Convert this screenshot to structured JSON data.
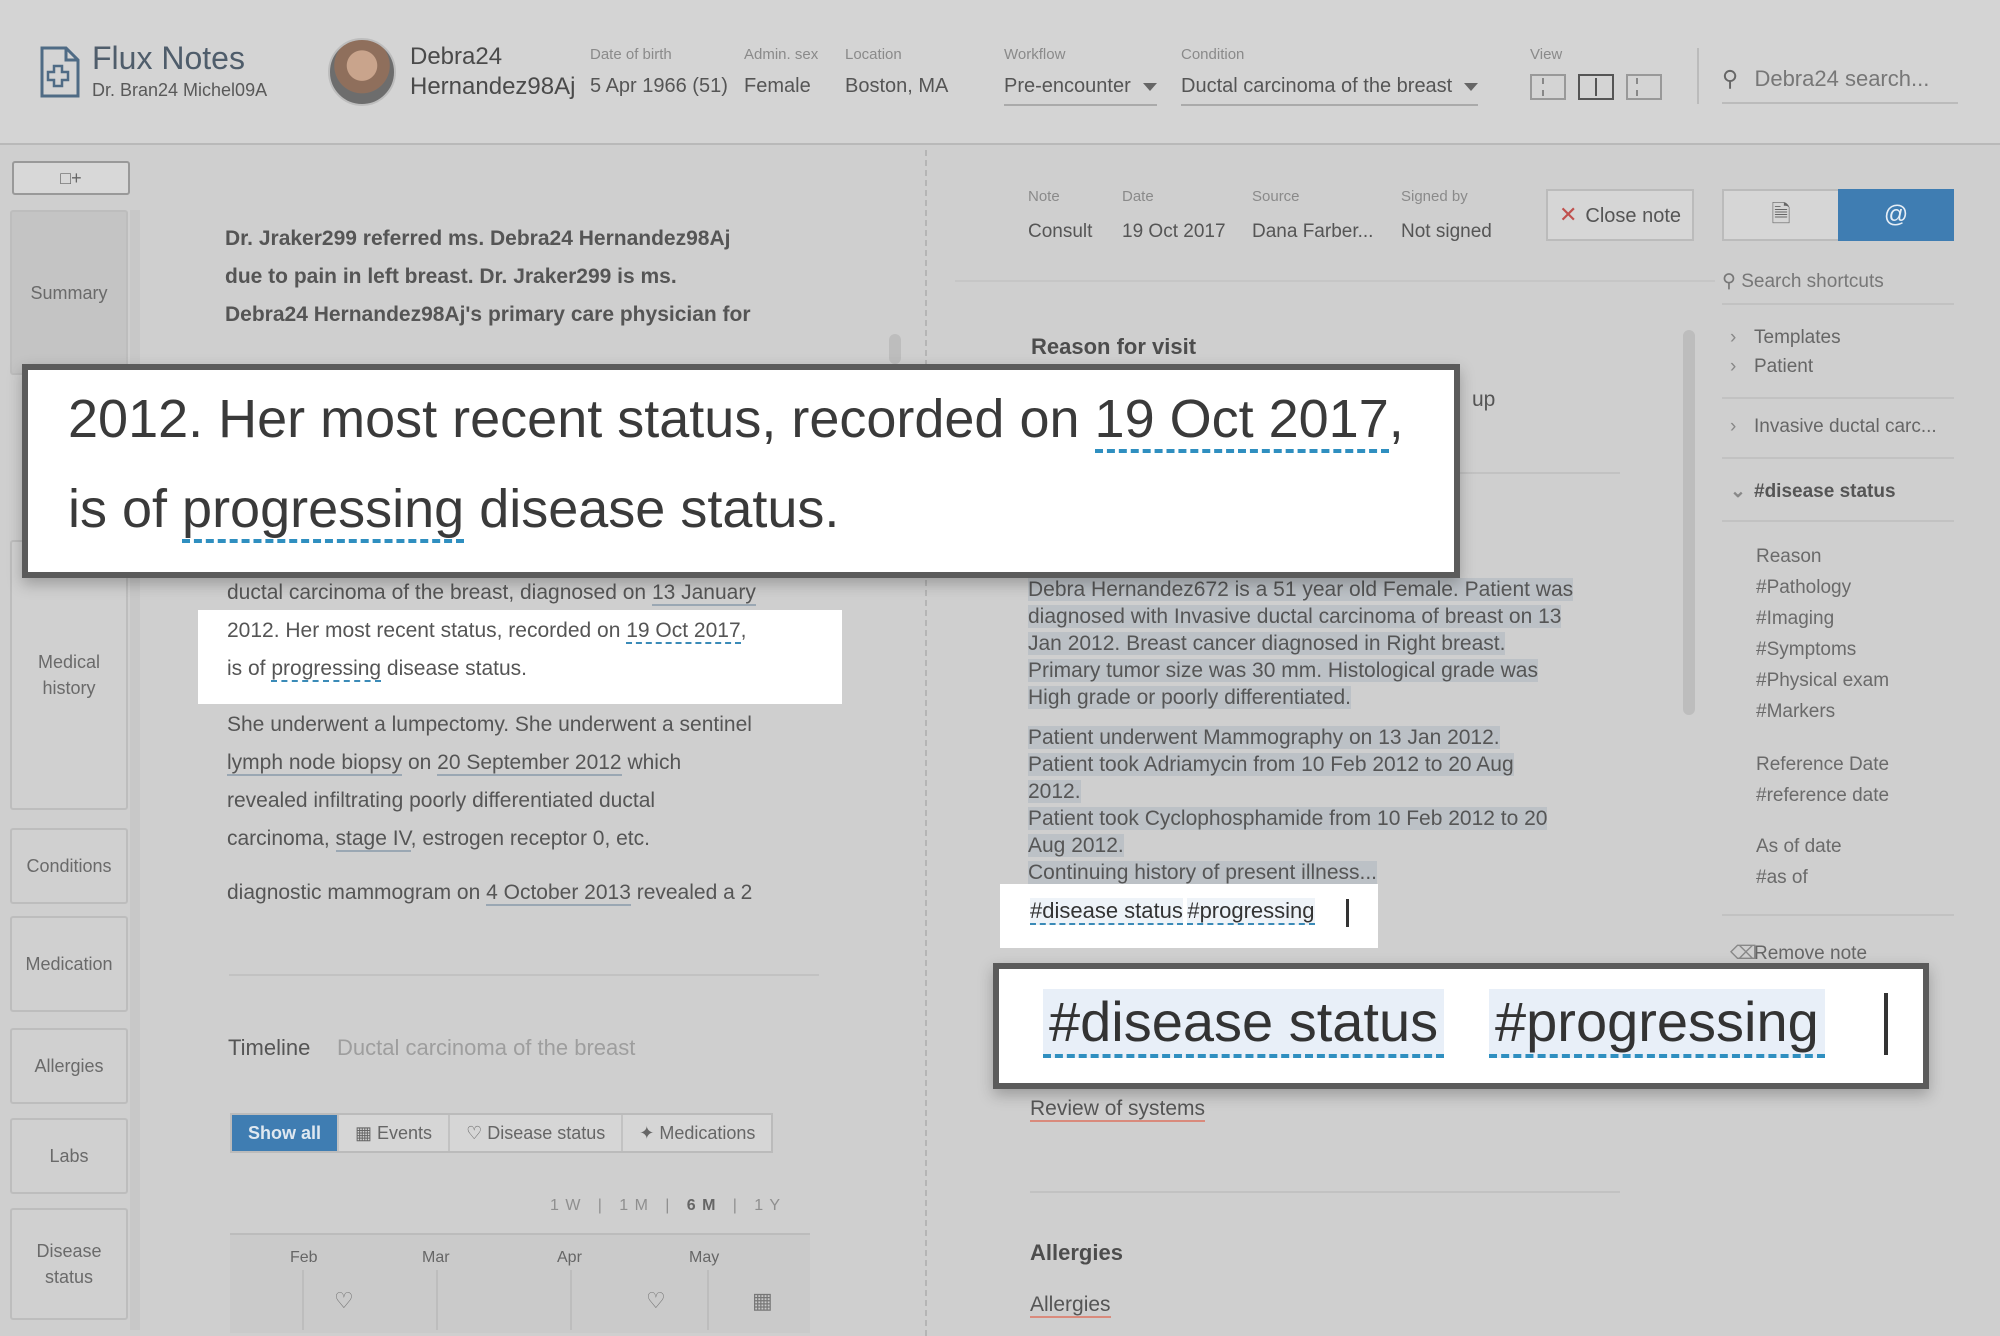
{
  "header": {
    "app_name": "Flux Notes",
    "user_name": "Dr. Bran24 Michel09A",
    "patient_name": "Debra24 Hernandez98Aj",
    "dob_label": "Date of birth",
    "dob_value": "5 Apr 1966 (51)",
    "sex_label": "Admin. sex",
    "sex_value": "Female",
    "location_label": "Location",
    "location_value": "Boston, MA",
    "workflow_label": "Workflow",
    "workflow_value": "Pre-encounter",
    "condition_label": "Condition",
    "condition_value": "Ductal carcinoma of the breast",
    "view_label": "View",
    "search_placeholder": "Debra24 search..."
  },
  "sidebar": {
    "tabs": [
      "Summary",
      "Medical history",
      "Conditions",
      "Medication",
      "Allergies",
      "Labs",
      "Disease status"
    ]
  },
  "summary": {
    "intro_line1": "Dr. Jraker299 referred ms. Debra24 Hernandez98Aj",
    "intro_line2": "due to pain in left breast. Dr. Jraker299 is ms.",
    "intro_line3": "Debra24 Hernandez98Aj's primary care physician for",
    "p1_line1_a": "ductal carcinoma of the breast, diagnosed on ",
    "p1_line1_b": "13 January",
    "p1_line2_a": "2012.  Her most recent status, recorded on ",
    "p1_line2_b": "19 Oct 2017",
    "p1_line2_c": ",",
    "p1_line3_a": "is of ",
    "p1_line3_b": "progressing",
    "p1_line3_c": " disease status.",
    "p2_line1": "She underwent a lumpectomy. She underwent a sentinel",
    "p2_line2_a": "lymph node biopsy",
    "p2_line2_b": " on ",
    "p2_line2_c": "20 September 2012",
    "p2_line2_d": " which",
    "p2_line3": "revealed infiltrating poorly differentiated ductal",
    "p2_line4_a": "carcinoma, ",
    "p2_line4_b": "stage IV",
    "p2_line4_c": ", estrogen receptor 0, etc.",
    "p3_line1_a": "diagnostic mammogram on ",
    "p3_line1_b": "4 October 2013",
    "p3_line1_c": " revealed a 2"
  },
  "timeline": {
    "title": "Timeline",
    "subtitle": "Ductal carcinoma of the breast",
    "filters": [
      "Show all",
      "Events",
      "Disease status",
      "Medications"
    ],
    "ranges": [
      "1 W",
      "1 M",
      "6 M",
      "1 Y"
    ],
    "selected_range": "6 M",
    "months": [
      "Feb",
      "Mar",
      "Apr",
      "May"
    ]
  },
  "note": {
    "note_label": "Note",
    "note_value": "Consult",
    "date_label": "Date",
    "date_value": "19 Oct 2017",
    "source_label": "Source",
    "source_value": "Dana Farber...",
    "signed_label": "Signed by",
    "signed_value": "Not signed",
    "close_label": "Close note",
    "reason_heading": "Reason for visit",
    "reason_fragment": "up",
    "hpi_lines": [
      "Debra Hernandez672 is a 51 year old Female. Patient was",
      "diagnosed with Invasive ductal carcinoma of breast on 13",
      "Jan 2012. Breast cancer diagnosed in Right breast.",
      "Primary tumor size was 30 mm. Histological grade was",
      "High grade or poorly differentiated."
    ],
    "hpi2_lines": [
      "Patient underwent Mammography on 13 Jan 2012.",
      "Patient took Adriamycin from 10 Feb 2012 to 20 Aug",
      "2012.",
      "Patient took Cyclophosphamide from 10 Feb 2012 to 20",
      "Aug 2012.",
      "Continuing history of present illness..."
    ],
    "tag1": "#disease status",
    "tag2": "#progressing",
    "review_of_systems": "Review of systems",
    "allergies_heading": "Allergies",
    "allergies_link": "Allergies"
  },
  "shortcuts": {
    "search_placeholder": "Search shortcuts",
    "groups": [
      "Templates",
      "Patient",
      "Invasive ductal carc...",
      "#disease status"
    ],
    "reason_label": "Reason",
    "reason_items": [
      "#Pathology",
      "#Imaging",
      "#Symptoms",
      "#Physical exam",
      "#Markers"
    ],
    "ref_label": "Reference Date",
    "ref_item": "#reference date",
    "asof_label": "As of date",
    "asof_item": "#as of",
    "remove_label": "Remove note"
  },
  "zoom": {
    "line1_a": "2012.  Her most recent status, recorded on ",
    "line1_b": "19 Oct 2017",
    "line1_c": ",",
    "line2_a": "is of ",
    "line2_b": "progressing",
    "line2_c": " disease status.",
    "tag1": "#disease status",
    "tag2": "#progressing"
  },
  "colors": {
    "accent": "#3f7db2",
    "dashed_underline": "#3a8ab7",
    "close_x": "#c0504d"
  },
  "icons": [
    "logo-document-icon",
    "search-icon",
    "add-note-icon",
    "view-left-icon",
    "view-split-icon",
    "view-right-icon",
    "note-icon",
    "at-icon",
    "calendar-icon",
    "heart-icon",
    "pill-icon",
    "trash-icon",
    "chevron-right-icon",
    "chevron-down-icon"
  ]
}
